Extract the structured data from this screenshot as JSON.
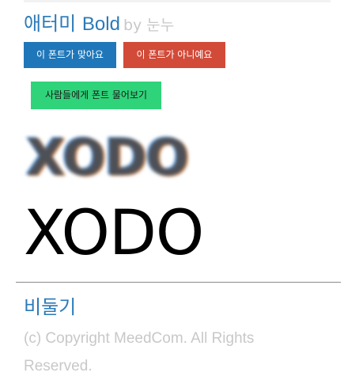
{
  "title": {
    "font_name_korean": "애터미",
    "font_name_latin": "Bold",
    "author": "by 눈누"
  },
  "buttons": {
    "yes_label": "이 폰트가 맞아요",
    "no_label": "이 폰트가 아니예요",
    "ask_label": "사람들에게 폰트 물어보기"
  },
  "preview": {
    "blurred_text": "XODO",
    "sharp_text": "XODO"
  },
  "next_font": "비둘기",
  "footer": {
    "copyright": "(c) Copyright MeedCom. All Rights Reserved."
  },
  "colors": {
    "link_blue": "#2a7ab8",
    "yes_button": "#1f77b9",
    "no_button": "#d24a38",
    "ask_button": "#2fd47a",
    "muted_gray": "#c8c8c8"
  }
}
